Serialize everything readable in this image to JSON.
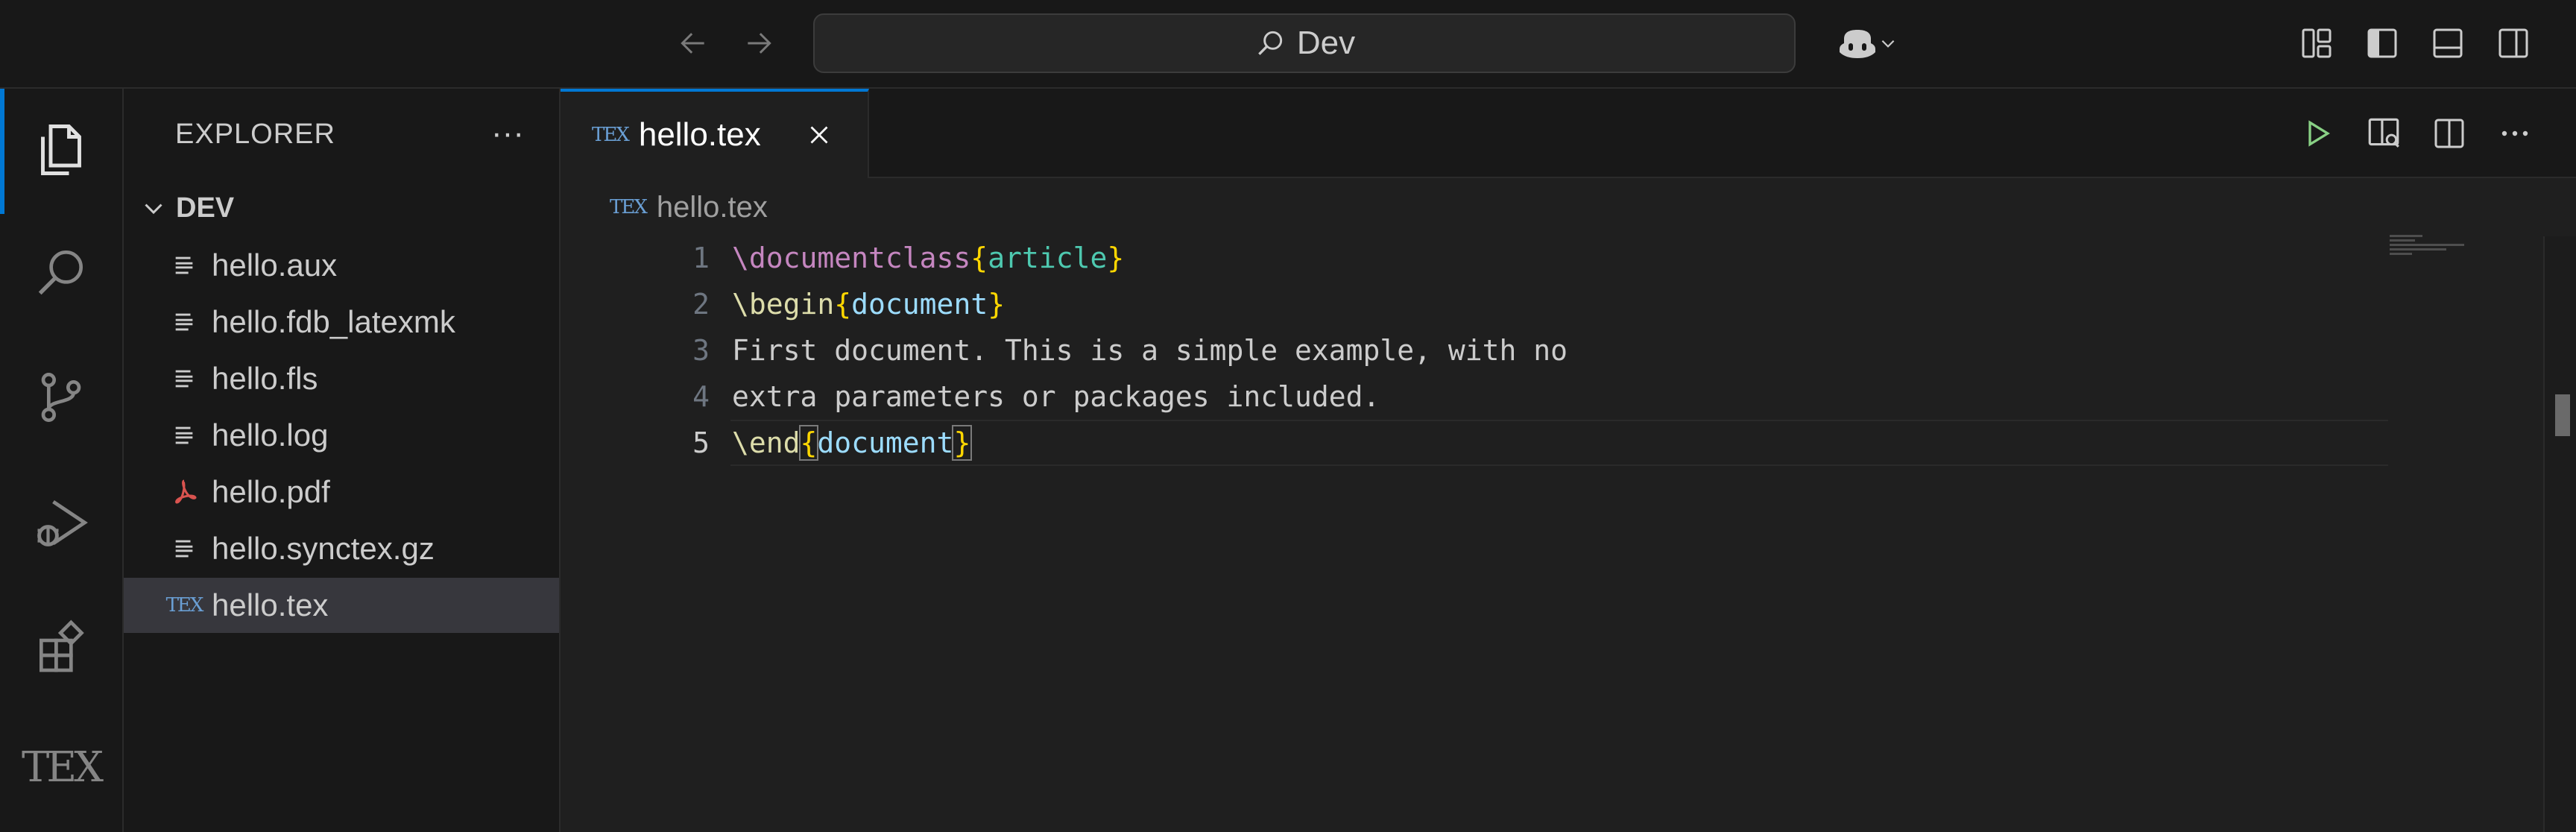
{
  "titlebar": {
    "search_label": "Dev"
  },
  "sidebar": {
    "title": "EXPLORER",
    "more": "···",
    "folder": "DEV",
    "files": [
      {
        "name": "hello.aux",
        "icon": "text-file-icon"
      },
      {
        "name": "hello.fdb_latexmk",
        "icon": "text-file-icon"
      },
      {
        "name": "hello.fls",
        "icon": "text-file-icon"
      },
      {
        "name": "hello.log",
        "icon": "text-file-icon"
      },
      {
        "name": "hello.pdf",
        "icon": "pdf-file-icon"
      },
      {
        "name": "hello.synctex.gz",
        "icon": "text-file-icon"
      },
      {
        "name": "hello.tex",
        "icon": "tex-file-icon",
        "selected": true
      }
    ]
  },
  "tex_glyph": "TEX",
  "activity_tex": "TEX",
  "editor": {
    "tab_label": "hello.tex",
    "breadcrumb": "hello.tex",
    "lines": [
      {
        "n": "1"
      },
      {
        "n": "2"
      },
      {
        "n": "3"
      },
      {
        "n": "4"
      },
      {
        "n": "5"
      }
    ],
    "code": {
      "l1": {
        "cmd": "\\documentclass",
        "open": "{",
        "arg": "article",
        "close": "}"
      },
      "l2": {
        "cmd": "\\begin",
        "open": "{",
        "arg": "document",
        "close": "}"
      },
      "l3": "First document. This is a simple example, with no",
      "l4": "extra parameters or packages included.",
      "l5": {
        "cmd": "\\end",
        "open": "{",
        "arg": "document",
        "close": "}"
      }
    }
  },
  "colors": {
    "accent": "#0078d4",
    "run_green": "#89d185",
    "pdf_red": "#d9534f"
  }
}
